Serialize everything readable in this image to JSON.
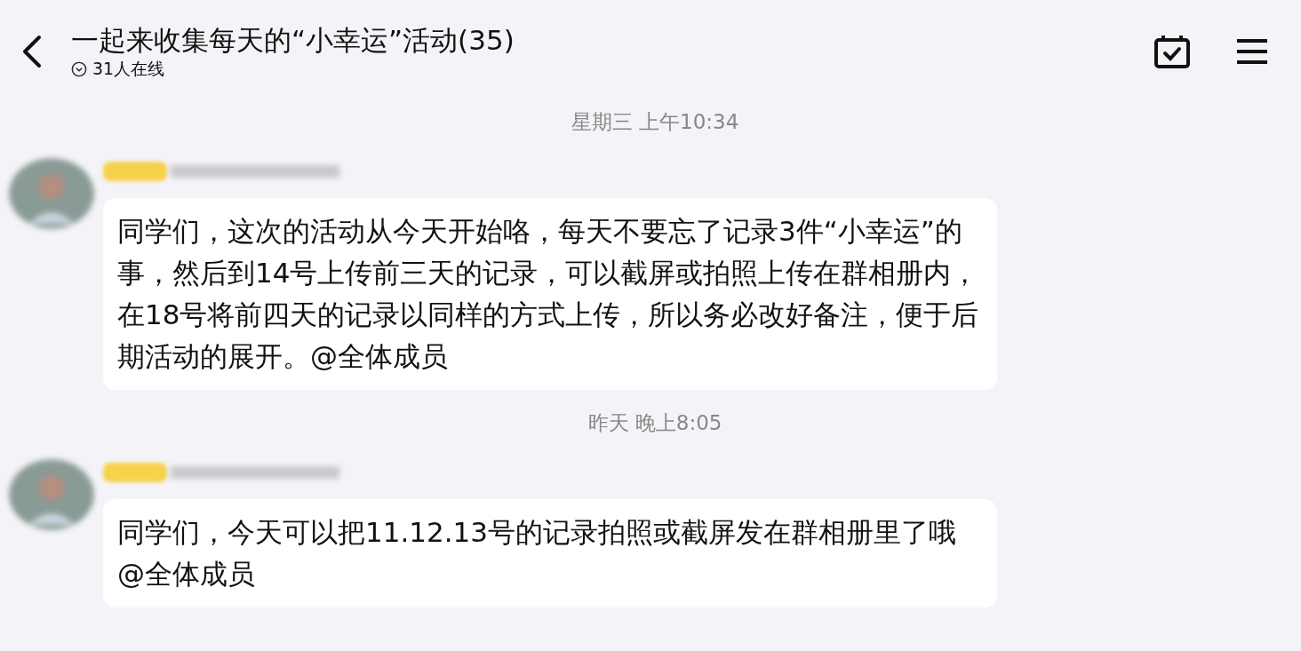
{
  "header": {
    "title": "一起来收集每天的“小幸运”活动(35)",
    "online_status": "31人在线"
  },
  "messages": [
    {
      "timestamp": "星期三 上午10:34",
      "text": "同学们，这次的活动从今天开始咯，每天不要忘了记录3件“小幸运”的事，然后到14号上传前三天的记录，可以截屏或拍照上传在群相册内，在18号将前四天的记录以同样的方式上传，所以务必改好备注，便于后期活动的展开。@全体成员"
    },
    {
      "timestamp": "昨天 晚上8:05",
      "text": "同学们，今天可以把11.12.13号的记录拍照或截屏发在群相册里了哦@全体成员"
    }
  ]
}
